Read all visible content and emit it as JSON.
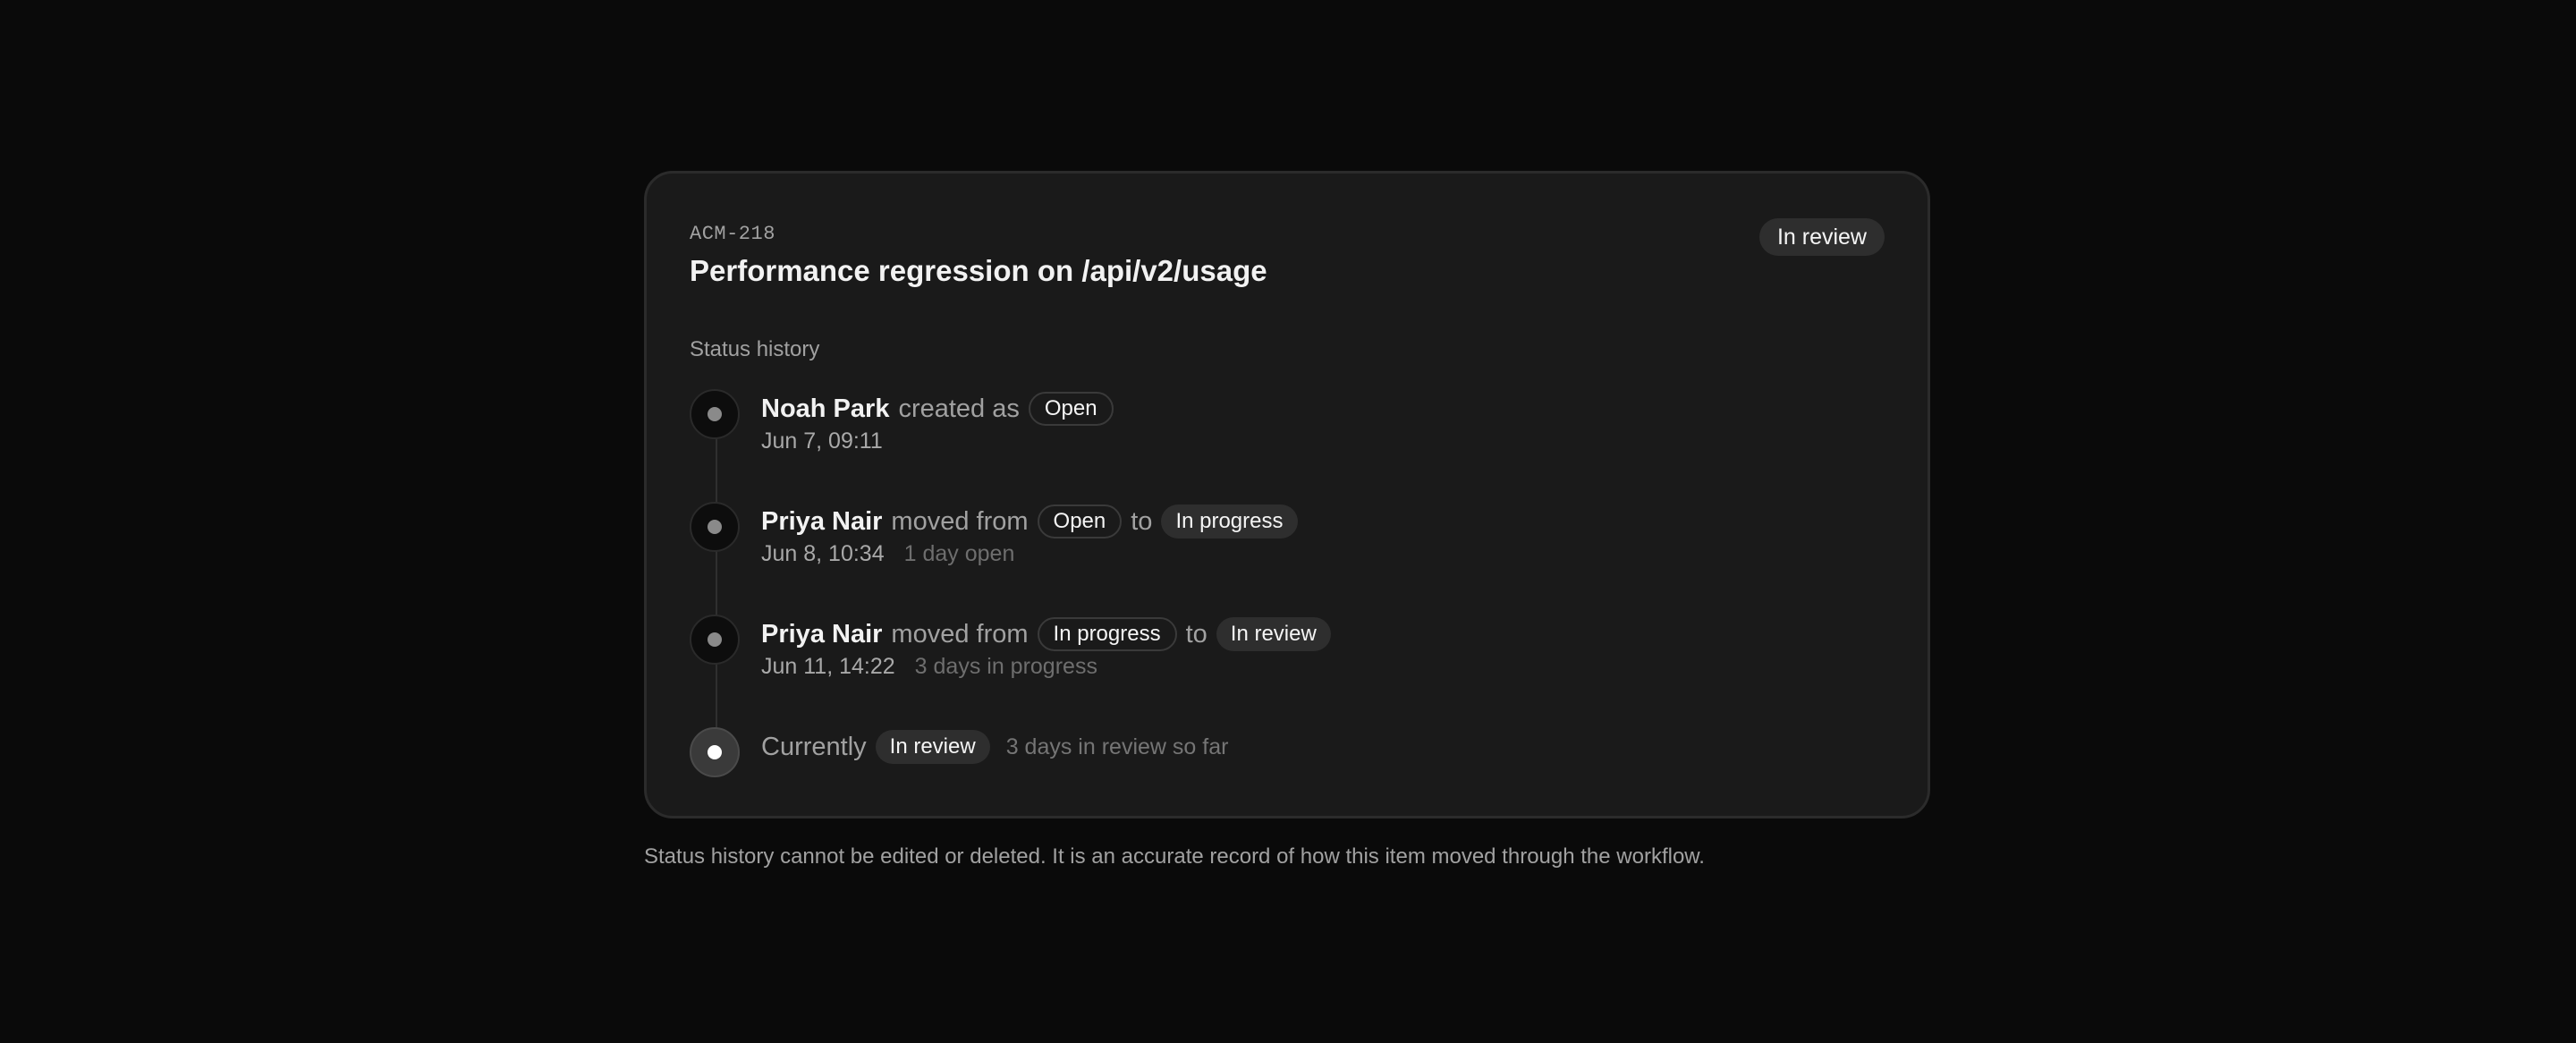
{
  "issue": {
    "id": "ACM-218",
    "title": "Performance regression on /api/v2/usage",
    "status": "In review"
  },
  "history": {
    "label": "Status history",
    "entries": [
      {
        "actor": "Noah Park",
        "verb": "created as",
        "status": "Open",
        "date": "Jun 7, 09:11"
      },
      {
        "actor": "Priya Nair",
        "verb": "moved from",
        "from": "Open",
        "to_word": "to",
        "to": "In progress",
        "date": "Jun 8, 10:34",
        "duration": "1 day open"
      },
      {
        "actor": "Priya Nair",
        "verb": "moved from",
        "from": "In progress",
        "to_word": "to",
        "to": "In review",
        "date": "Jun 11, 14:22",
        "duration": "3 days in progress"
      }
    ],
    "current": {
      "label": "Currently",
      "status": "In review",
      "duration": "3 days in review so far"
    }
  },
  "footnote": "Status history cannot be edited or deleted. It is an accurate record of how this item moved through the workflow."
}
